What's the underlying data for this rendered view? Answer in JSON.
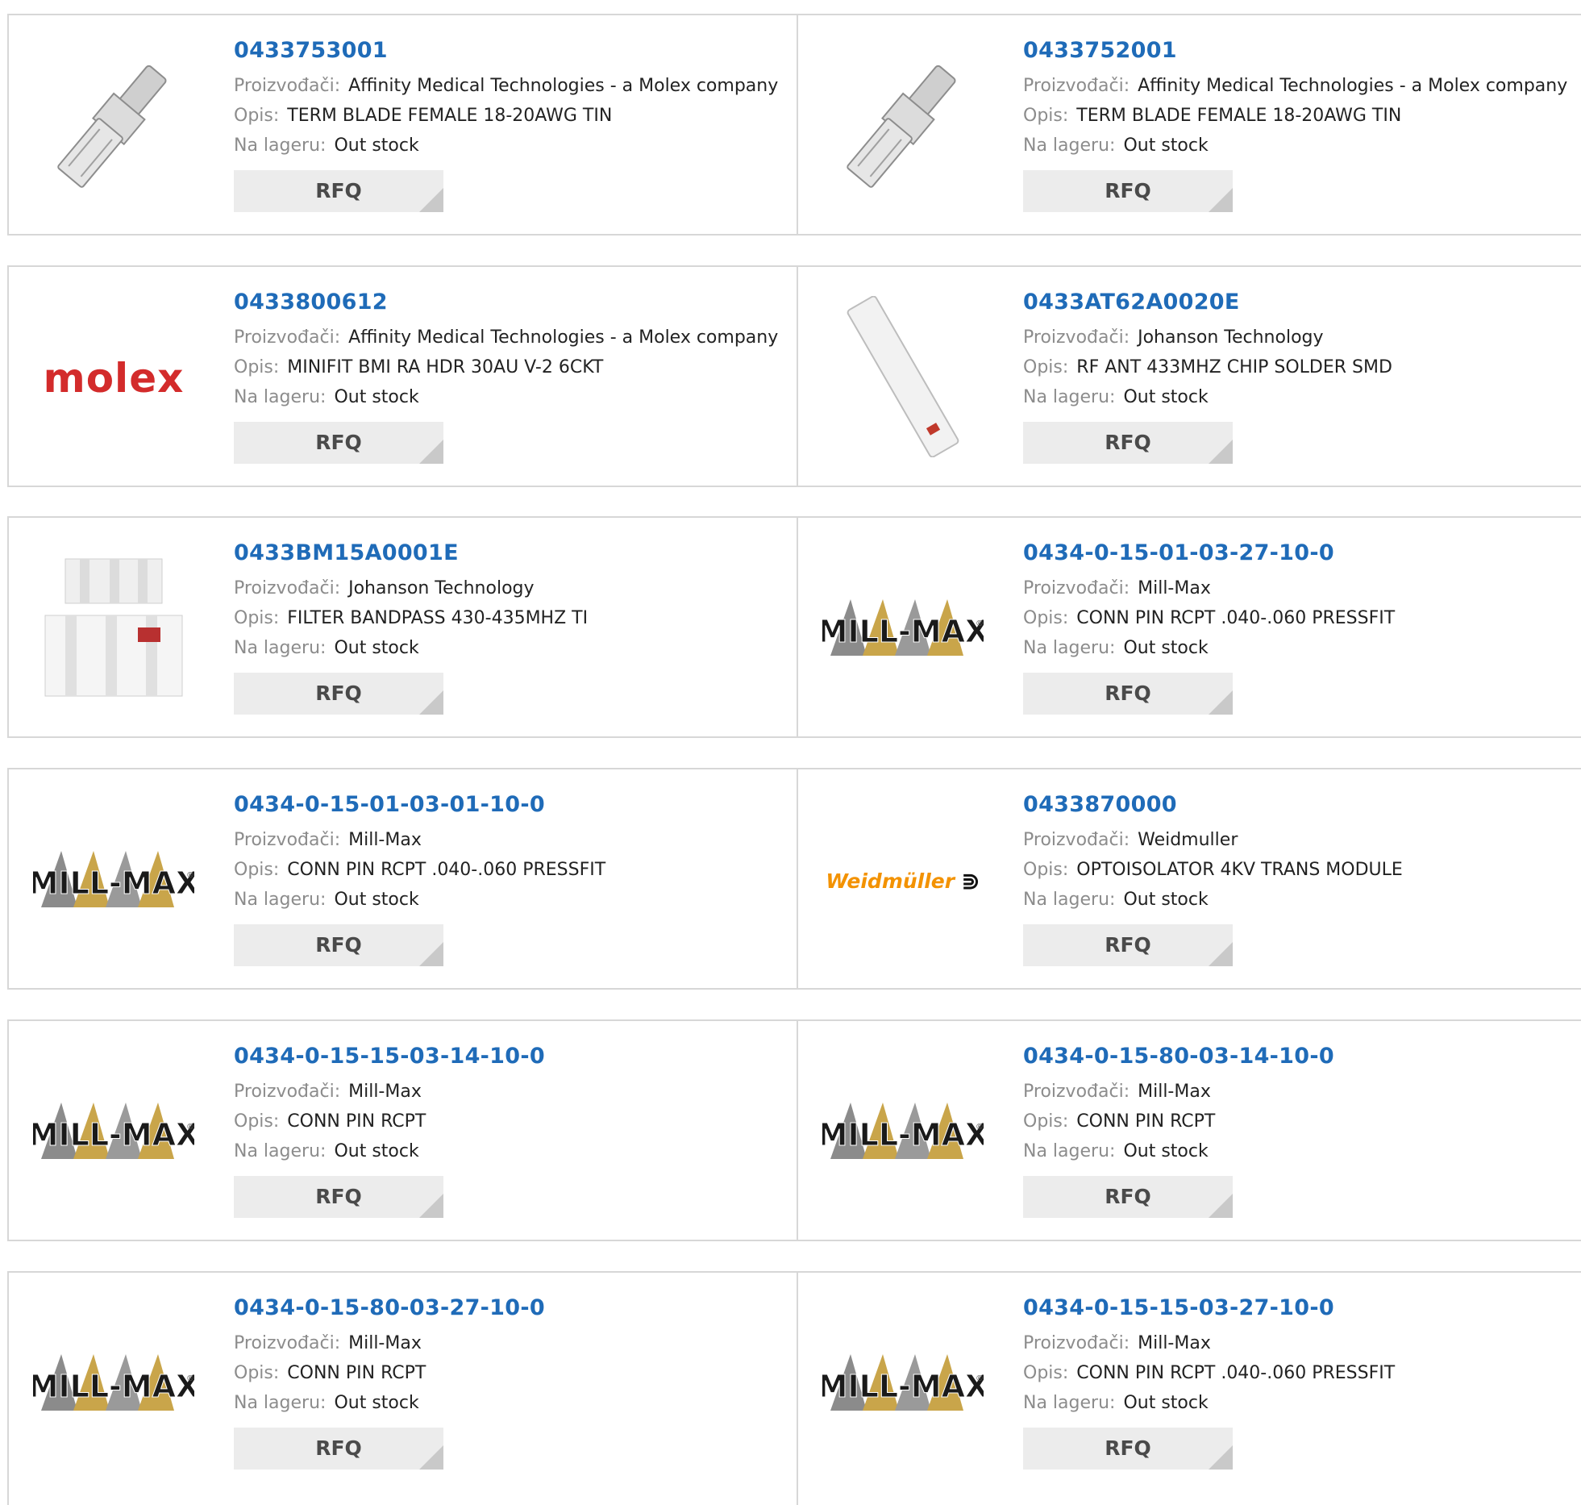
{
  "labels": {
    "manufacturer": "Proizvođači:",
    "description": "Opis:",
    "stock": "Na lageru:",
    "rfq": "RFQ"
  },
  "logos": {
    "molex": "molex",
    "weidmuller": "Weidmüller",
    "millmax": "MILL-MAX"
  },
  "products": [
    {
      "part_number": "0433753001",
      "manufacturer": "Affinity Medical Technologies - a Molex company",
      "description": "TERM BLADE FEMALE 18-20AWG TIN",
      "stock": "Out stock",
      "image": "terminal-photo"
    },
    {
      "part_number": "0433752001",
      "manufacturer": "Affinity Medical Technologies - a Molex company",
      "description": "TERM BLADE FEMALE 18-20AWG TIN",
      "stock": "Out stock",
      "image": "terminal-photo"
    },
    {
      "part_number": "0433800612",
      "manufacturer": "Affinity Medical Technologies - a Molex company",
      "description": "MINIFIT BMI RA HDR 30AU V-2 6CKT",
      "stock": "Out stock",
      "image": "molex-logo"
    },
    {
      "part_number": "0433AT62A0020E",
      "manufacturer": "Johanson Technology",
      "description": "RF ANT 433MHZ CHIP SOLDER SMD",
      "stock": "Out stock",
      "image": "chip-antenna-photo"
    },
    {
      "part_number": "0433BM15A0001E",
      "manufacturer": "Johanson Technology",
      "description": "FILTER BANDPASS 430-435MHZ TI",
      "stock": "Out stock",
      "image": "filter-photo"
    },
    {
      "part_number": "0434-0-15-01-03-27-10-0",
      "manufacturer": "Mill-Max",
      "description": "CONN PIN RCPT .040-.060 PRESSFIT",
      "stock": "Out stock",
      "image": "millmax-logo"
    },
    {
      "part_number": "0434-0-15-01-03-01-10-0",
      "manufacturer": "Mill-Max",
      "description": "CONN PIN RCPT .040-.060 PRESSFIT",
      "stock": "Out stock",
      "image": "millmax-logo"
    },
    {
      "part_number": "0433870000",
      "manufacturer": "Weidmuller",
      "description": "OPTOISOLATOR 4KV TRANS MODULE",
      "stock": "Out stock",
      "image": "weidmuller-logo"
    },
    {
      "part_number": "0434-0-15-15-03-14-10-0",
      "manufacturer": "Mill-Max",
      "description": "CONN PIN RCPT",
      "stock": "Out stock",
      "image": "millmax-logo"
    },
    {
      "part_number": "0434-0-15-80-03-14-10-0",
      "manufacturer": "Mill-Max",
      "description": "CONN PIN RCPT",
      "stock": "Out stock",
      "image": "millmax-logo"
    },
    {
      "part_number": "0434-0-15-80-03-27-10-0",
      "manufacturer": "Mill-Max",
      "description": "CONN PIN RCPT",
      "stock": "Out stock",
      "image": "millmax-logo"
    },
    {
      "part_number": "0434-0-15-15-03-27-10-0",
      "manufacturer": "Mill-Max",
      "description": "CONN PIN RCPT .040-.060 PRESSFIT",
      "stock": "Out stock",
      "image": "millmax-logo"
    }
  ]
}
